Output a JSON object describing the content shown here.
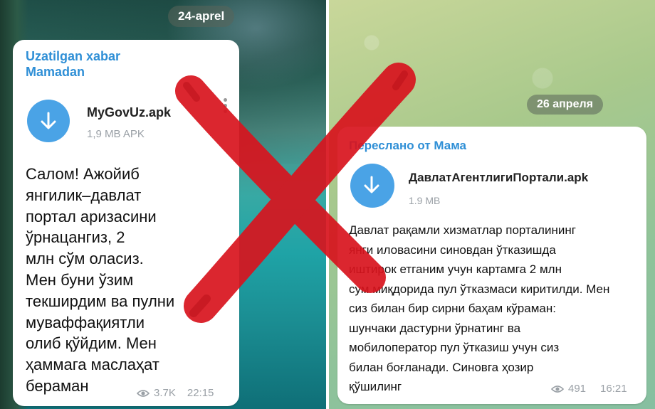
{
  "left": {
    "date": "24-aprel",
    "forward_label": "Uzatilgan xabar",
    "forward_from": "Mamadan",
    "file_name": "MyGovUz.apk",
    "file_size": "1,9 MB APK",
    "message_lines": [
      "Салом! Ажойиб",
      "янгилик–давлат",
      "портал аризасини",
      "ўрнацангиз, 2",
      "млн сўм оласиз.",
      "Мен буни ўзим",
      "текширдим ва пулни",
      "муваффақиятли",
      "олиб қўйдим. Мен",
      "ҳаммага маслаҳат",
      "бераман"
    ],
    "views": "3.7K",
    "time": "22:15"
  },
  "right": {
    "date": "26 апреля",
    "forward_label": "Переслано от Мама",
    "file_name": "ДавлатАгентлигиПортали.apk",
    "file_size": "1.9 MB",
    "message_lines": [
      "Давлат рақамли хизматлар порталининг",
      "янги иловасини синовдан ўтказишда",
      "иштирок етганим учун картамга 2 млн",
      "сум миқдорида пул ўтказмаси киритилди. Мен",
      "сиз билан бир сирни баҳам кўраман:",
      "шунчаки дастурни ўрнатинг ва",
      "мобилоператор пул ўтказиш учун сиз",
      "билан боғланади. Синовга ҳозир",
      "қўшилинг"
    ],
    "views": "491",
    "time": "16:21"
  },
  "colors": {
    "accent": "#4aa3e6",
    "forward": "#2f8fd6",
    "cross": "#d8141e"
  },
  "icons": {
    "download": "download-arrow-icon",
    "views": "eye-icon",
    "menu": "more-vertical-icon"
  }
}
